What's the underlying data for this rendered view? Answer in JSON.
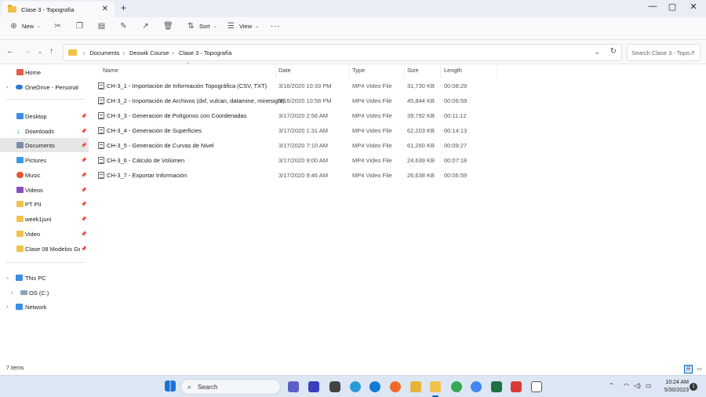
{
  "window": {
    "tab_title": "Clase 3 - Topografía",
    "tab_close": "✕",
    "new_tab": "+",
    "minimize": "—",
    "maximize": "▢",
    "close": "✕"
  },
  "toolbar": {
    "new_label": "New",
    "sort_label": "Sort",
    "view_label": "View",
    "more_label": "···"
  },
  "address": {
    "crumbs": [
      "Documents",
      "Deswik Course",
      "Clase 3 - Topografía"
    ],
    "search_placeholder": "Search Clase 3 - Topo..."
  },
  "sidebar": {
    "items": [
      {
        "label": "Home"
      },
      {
        "label": "OneDrive - Personal"
      },
      {
        "label": "Desktop"
      },
      {
        "label": "Downloads"
      },
      {
        "label": "Documents"
      },
      {
        "label": "Pictures"
      },
      {
        "label": "Music"
      },
      {
        "label": "Videos"
      },
      {
        "label": "PT PII"
      },
      {
        "label": "week1juni"
      },
      {
        "label": "Video"
      },
      {
        "label": "Clase 08 Modelos Geol"
      },
      {
        "label": "This PC"
      },
      {
        "label": "OS (C:)"
      },
      {
        "label": "Network"
      }
    ]
  },
  "columns": {
    "name": "Name",
    "date": "Date",
    "type": "Type",
    "size": "Size",
    "length": "Length"
  },
  "files": [
    {
      "name": "CH-3_1 - Importación de Información Topográfica (CSV, TXT)",
      "date": "3/16/2020 10:33 PM",
      "type": "MP4 Video File",
      "size": "31,730 KB",
      "length": "00:08:29"
    },
    {
      "name": "CH-3_2 - Importación de Archivos (dxf, vulcan, datamine, minesight)",
      "date": "3/16/2020 10:58 PM",
      "type": "MP4 Video File",
      "size": "45,844 KB",
      "length": "00:06:59"
    },
    {
      "name": "CH-3_3 - Generación de Polígonos con Coordenadas",
      "date": "3/17/2020 2:56 AM",
      "type": "MP4 Video File",
      "size": "39,792 KB",
      "length": "00:11:12"
    },
    {
      "name": "CH-3_4 - Generación de Superficies",
      "date": "3/17/2020 1:31 AM",
      "type": "MP4 Video File",
      "size": "62,203 KB",
      "length": "00:14:13"
    },
    {
      "name": "CH-3_5 - Generación de Curvas de Nivel",
      "date": "3/17/2020 7:10 AM",
      "type": "MP4 Video File",
      "size": "61,260 KB",
      "length": "00:09:27"
    },
    {
      "name": "CH-3_6 - Cálculo de Volúmen",
      "date": "3/17/2020 9:00 AM",
      "type": "MP4 Video File",
      "size": "24,639 KB",
      "length": "00:07:18"
    },
    {
      "name": "CH-3_7 - Exportar Información",
      "date": "3/17/2020 9:46 AM",
      "type": "MP4 Video File",
      "size": "26,638 KB",
      "length": "00:06:59"
    }
  ],
  "status": {
    "count": "7 items"
  },
  "taskbar": {
    "search_label": "Search",
    "time": "10:24 AM",
    "date": "5/30/2023",
    "notifications": "1"
  },
  "colors": {
    "accent": "#0067c0",
    "folder": "#f0c24b",
    "taskbar": "#dde6f3"
  }
}
